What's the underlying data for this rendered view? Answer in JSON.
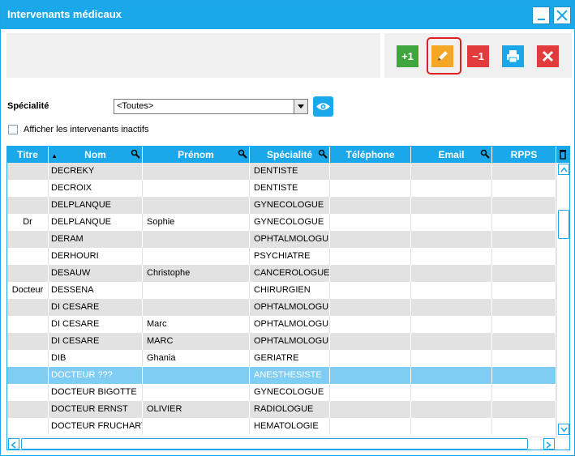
{
  "window": {
    "title": "Intervenants médicaux"
  },
  "toolbar": {
    "add_label": "+1",
    "remove_label": "−1"
  },
  "filter": {
    "specialite_label": "Spécialité",
    "specialite_value": "<Toutes>",
    "show_inactive_label": "Afficher les intervenants inactifs",
    "show_inactive_checked": false
  },
  "columns": [
    "Titre",
    "Nom",
    "Prénom",
    "Spécialité",
    "Téléphone",
    "Email",
    "RPPS"
  ],
  "rows": [
    {
      "titre": "",
      "nom": "DECREKY",
      "prenom": "",
      "specialite": "DENTISTE",
      "telephone": "",
      "email": "",
      "rpps": ""
    },
    {
      "titre": "",
      "nom": "DECROIX",
      "prenom": "",
      "specialite": "DENTISTE",
      "telephone": "",
      "email": "",
      "rpps": ""
    },
    {
      "titre": "",
      "nom": "DELPLANQUE",
      "prenom": "",
      "specialite": "GYNECOLOGUE",
      "telephone": "",
      "email": "",
      "rpps": ""
    },
    {
      "titre": "Dr",
      "nom": "DELPLANQUE",
      "prenom": "Sophie",
      "specialite": "GYNECOLOGUE",
      "telephone": "",
      "email": "",
      "rpps": ""
    },
    {
      "titre": "",
      "nom": "DERAM",
      "prenom": "",
      "specialite": "OPHTALMOLOGUE",
      "telephone": "",
      "email": "",
      "rpps": ""
    },
    {
      "titre": "",
      "nom": "DERHOURI",
      "prenom": "",
      "specialite": "PSYCHIATRE",
      "telephone": "",
      "email": "",
      "rpps": ""
    },
    {
      "titre": "",
      "nom": "DESAUW",
      "prenom": "Christophe",
      "specialite": "CANCEROLOGUE",
      "telephone": "",
      "email": "",
      "rpps": ""
    },
    {
      "titre": "Docteur",
      "nom": "DESSENA",
      "prenom": "",
      "specialite": "CHIRURGIEN",
      "telephone": "",
      "email": "",
      "rpps": ""
    },
    {
      "titre": "",
      "nom": "DI CESARE",
      "prenom": "",
      "specialite": "OPHTALMOLOGUE",
      "telephone": "",
      "email": "",
      "rpps": ""
    },
    {
      "titre": "",
      "nom": "DI CESARE",
      "prenom": "Marc",
      "specialite": "OPHTALMOLOGUE",
      "telephone": "",
      "email": "",
      "rpps": ""
    },
    {
      "titre": "",
      "nom": "DI CESARE",
      "prenom": "MARC",
      "specialite": "OPHTALMOLOGUE",
      "telephone": "",
      "email": "",
      "rpps": ""
    },
    {
      "titre": "",
      "nom": "DIB",
      "prenom": "Ghania",
      "specialite": "GERIATRE",
      "telephone": "",
      "email": "",
      "rpps": ""
    },
    {
      "titre": "",
      "nom": "DOCTEUR ???",
      "prenom": "",
      "specialite": "ANESTHESISTE",
      "telephone": "",
      "email": "",
      "rpps": "",
      "selected": true
    },
    {
      "titre": "",
      "nom": "DOCTEUR BIGOTTE",
      "prenom": "",
      "specialite": "GYNECOLOGUE",
      "telephone": "",
      "email": "",
      "rpps": ""
    },
    {
      "titre": "",
      "nom": "DOCTEUR ERNST",
      "prenom": "OLIVIER",
      "specialite": "RADIOLOGUE",
      "telephone": "",
      "email": "",
      "rpps": ""
    },
    {
      "titre": "",
      "nom": "DOCTEUR FRUCHART",
      "prenom": "",
      "specialite": "HEMATOLOGIE",
      "telephone": "",
      "email": "",
      "rpps": ""
    }
  ],
  "colors": {
    "accent": "#1ba8ea",
    "row_alt": "#e2e2e2",
    "selected": "#7fcdf2"
  }
}
